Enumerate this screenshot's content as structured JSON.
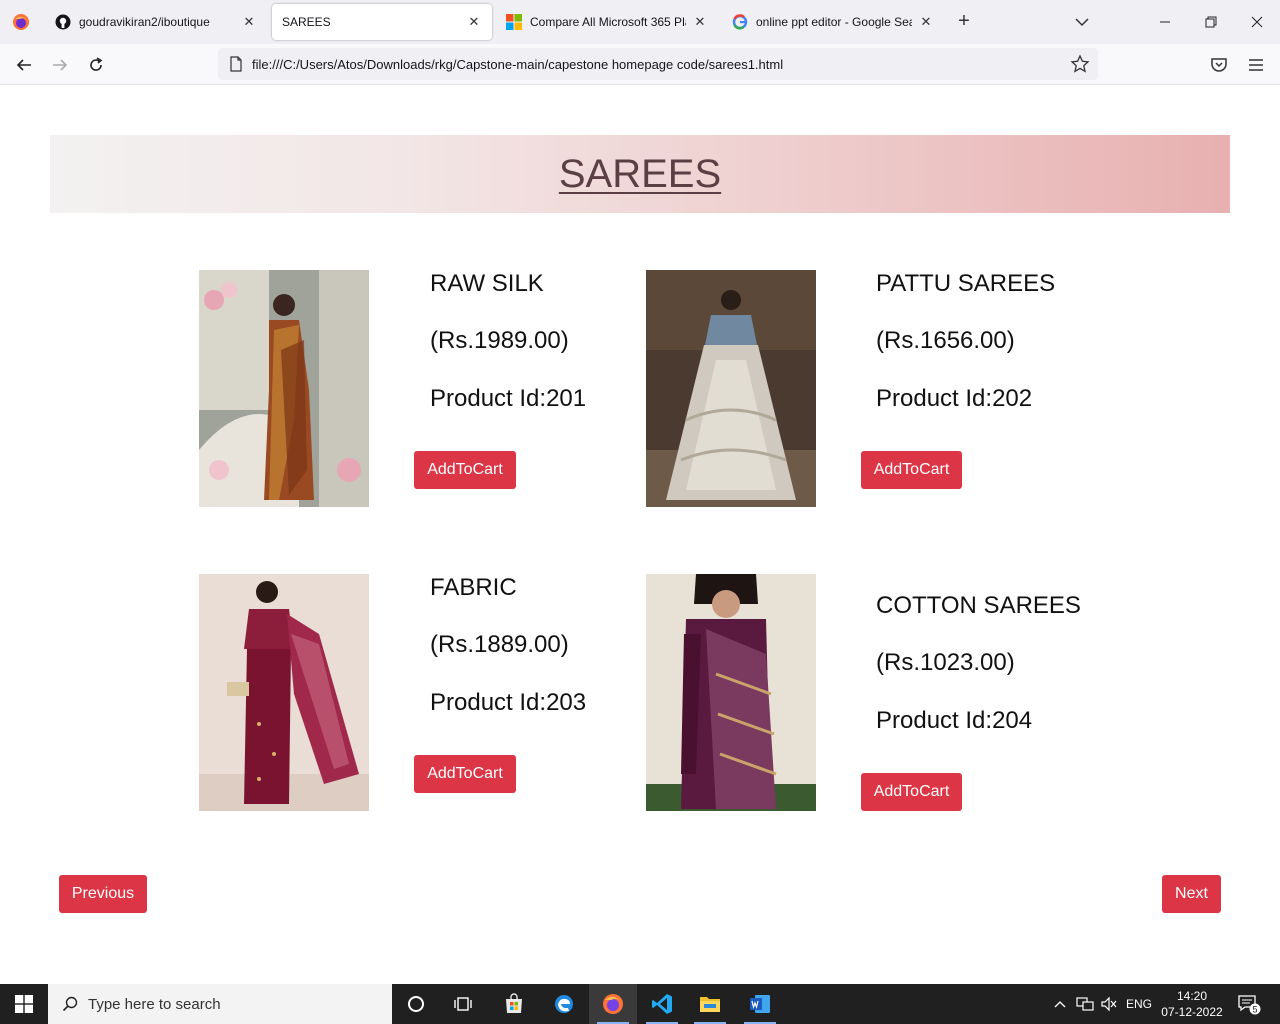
{
  "browser": {
    "tabs": [
      {
        "title": "goudravikiran2/iboutique",
        "icon": "github-icon",
        "active": false
      },
      {
        "title": "SAREES",
        "icon": "",
        "active": true
      },
      {
        "title": "Compare All Microsoft 365 Plans",
        "icon": "microsoft-icon",
        "active": false
      },
      {
        "title": "online ppt editor - Google Search",
        "icon": "google-icon",
        "active": false
      }
    ],
    "url": "file:///C:/Users/Atos/Downloads/rkg/Capstone-main/capestone homepage code/sarees1.html"
  },
  "page": {
    "title": "SAREES",
    "products": [
      {
        "name": "RAW SILK",
        "price": "(Rs.1989.00)",
        "product_id": "Product Id:201",
        "button": "AddToCart"
      },
      {
        "name": "PATTU SAREES",
        "price": "(Rs.1656.00)",
        "product_id": "Product Id:202",
        "button": "AddToCart"
      },
      {
        "name": "FABRIC",
        "price": "(Rs.1889.00)",
        "product_id": "Product Id:203",
        "button": "AddToCart"
      },
      {
        "name": "COTTON SAREES",
        "price": "(Rs.1023.00)",
        "product_id": "Product Id:204",
        "button": "AddToCart"
      }
    ],
    "previous_label": "Previous",
    "next_label": "Next",
    "colors": {
      "button": "#dc3545",
      "title": "#5a3f45"
    }
  },
  "taskbar": {
    "search_placeholder": "Type here to search",
    "language": "ENG",
    "time": "14:20",
    "date": "07-12-2022",
    "notification_count": "5"
  }
}
